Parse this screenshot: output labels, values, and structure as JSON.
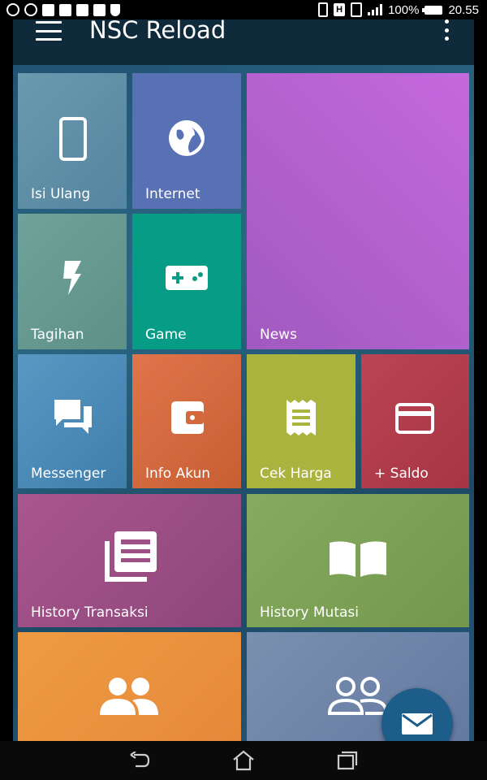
{
  "status_bar": {
    "left_icons": [
      "sync-100-icon",
      "s-icon",
      "facebook-icon",
      "facebook-icon",
      "facebook-icon",
      "gallery-icon",
      "shield-icon"
    ],
    "right_icons": [
      "vibrate-icon",
      "h-icon",
      "sim-icon",
      "signal-icon",
      "battery-icon"
    ],
    "h_label": "H",
    "battery": "100%",
    "time": "20.55"
  },
  "app_bar": {
    "title": "NSC Reload",
    "menu_icon": "hamburger-menu-icon",
    "overflow_icon": "more-vert-icon"
  },
  "tiles": [
    {
      "id": "isi-ulang",
      "label": "Isi Ulang",
      "icon": "smartphone-icon",
      "color": "#5e8fa6"
    },
    {
      "id": "internet",
      "label": "Internet",
      "icon": "globe-icon",
      "color": "#5871b4"
    },
    {
      "id": "news",
      "label": "News",
      "icon": "",
      "color": "#b160d0"
    },
    {
      "id": "tagihan",
      "label": "Tagihan",
      "icon": "flash-icon",
      "color": "#669c92"
    },
    {
      "id": "game",
      "label": "Game",
      "icon": "gamepad-icon",
      "color": "#079c86"
    },
    {
      "id": "messenger",
      "label": "Messenger",
      "icon": "chat-icon",
      "color": "#4d8cba"
    },
    {
      "id": "info-akun",
      "label": "Info Akun",
      "icon": "wallet-icon",
      "color": "#d5693e"
    },
    {
      "id": "cek-harga",
      "label": "Cek Harga",
      "icon": "receipt-icon",
      "color": "#aab33d"
    },
    {
      "id": "saldo",
      "label": "+ Saldo",
      "icon": "credit-card-icon",
      "color": "#b13e4d"
    },
    {
      "id": "history-transaksi",
      "label": "History Transaksi",
      "icon": "news-list-icon",
      "color": "#9d4f86"
    },
    {
      "id": "history-mutasi",
      "label": "History Mutasi",
      "icon": "book-open-icon",
      "color": "#7ea459"
    },
    {
      "id": "group",
      "label": "",
      "icon": "group-icon",
      "color": "#eb983e"
    },
    {
      "id": "group-outline",
      "label": "",
      "icon": "group-outline-icon",
      "color": "#6f86a8"
    }
  ],
  "fab": {
    "icon": "mail-icon",
    "color": "#1d5d8a"
  },
  "nav_bar": {
    "back_icon": "back-icon",
    "home_icon": "home-icon",
    "recents_icon": "recents-icon"
  }
}
